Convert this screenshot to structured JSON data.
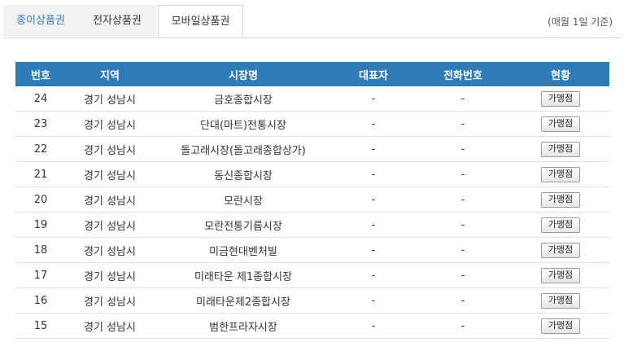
{
  "tabs": [
    {
      "label": "종이상품권"
    },
    {
      "label": "전자상품권"
    },
    {
      "label": "모바일상품권"
    }
  ],
  "note": "(매월 1일 기준)",
  "table": {
    "headers": [
      "번호",
      "지역",
      "시장명",
      "대표자",
      "전화번호",
      "현황"
    ],
    "rows": [
      {
        "no": "24",
        "region": "경기 성남시",
        "market": "금호종합시장",
        "rep": "-",
        "phone": "-",
        "status": "가맹점"
      },
      {
        "no": "23",
        "region": "경기 성남시",
        "market": "단대(마트)전통시장",
        "rep": "-",
        "phone": "-",
        "status": "가맹점"
      },
      {
        "no": "22",
        "region": "경기 성남시",
        "market": "돌고래시장(돌고래종합상가)",
        "rep": "-",
        "phone": "-",
        "status": "가맹점"
      },
      {
        "no": "21",
        "region": "경기 성남시",
        "market": "동신종합시장",
        "rep": "-",
        "phone": "-",
        "status": "가맹점"
      },
      {
        "no": "20",
        "region": "경기 성남시",
        "market": "모란시장",
        "rep": "-",
        "phone": "-",
        "status": "가맹점"
      },
      {
        "no": "19",
        "region": "경기 성남시",
        "market": "모란전통기름시장",
        "rep": "-",
        "phone": "-",
        "status": "가맹점"
      },
      {
        "no": "18",
        "region": "경기 성남시",
        "market": "미금현대벤처빌",
        "rep": "-",
        "phone": "-",
        "status": "가맹점"
      },
      {
        "no": "17",
        "region": "경기 성남시",
        "market": "미래타운 제1종합시장",
        "rep": "-",
        "phone": "-",
        "status": "가맹점"
      },
      {
        "no": "16",
        "region": "경기 성남시",
        "market": "미래타운제2종합시장",
        "rep": "-",
        "phone": "-",
        "status": "가맹점"
      },
      {
        "no": "15",
        "region": "경기 성남시",
        "market": "범한프라자시장",
        "rep": "-",
        "phone": "-",
        "status": "가맹점"
      }
    ]
  }
}
